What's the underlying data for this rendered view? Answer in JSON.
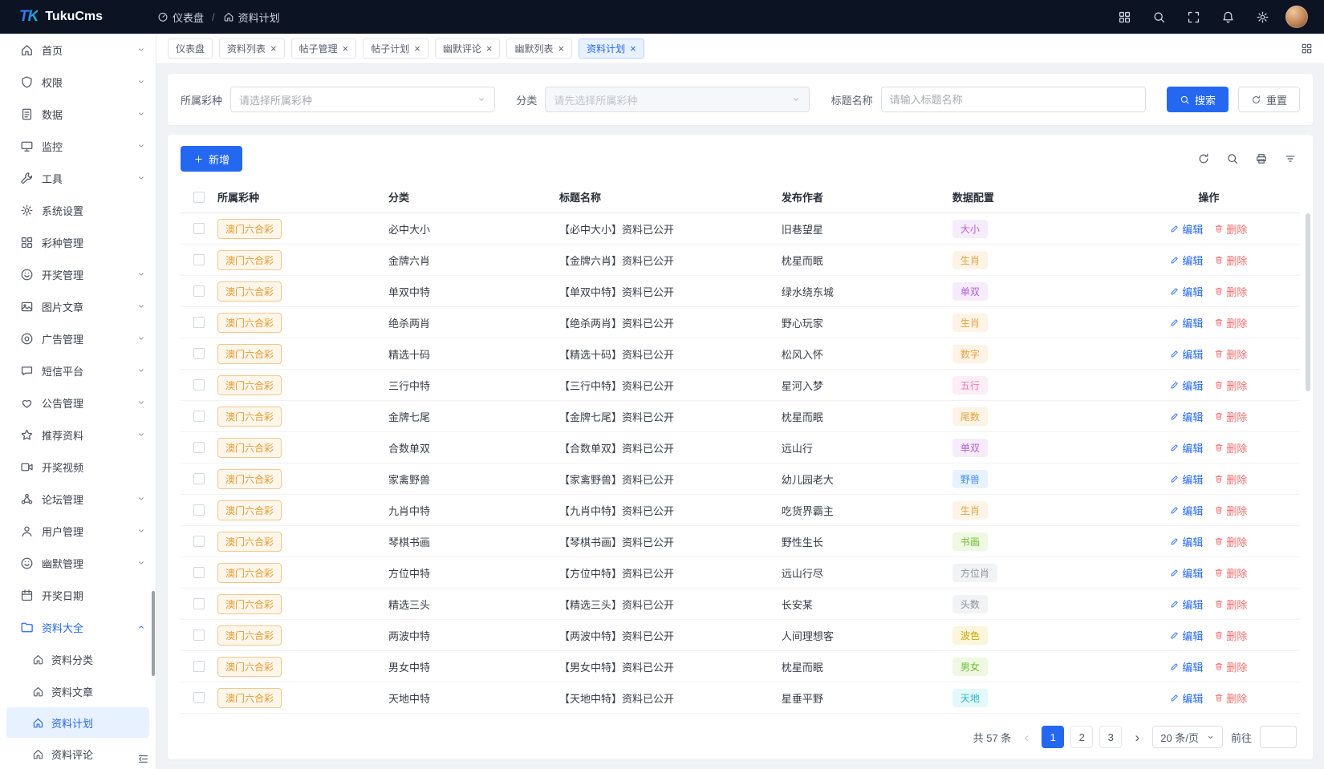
{
  "header": {
    "logo": "TK",
    "brand": "TukuCms",
    "breadcrumb": [
      {
        "label": "仪表盘",
        "icon": "dashboard"
      },
      {
        "label": "资料计划",
        "icon": "home"
      }
    ],
    "action_icons": [
      {
        "name": "apps"
      },
      {
        "name": "search"
      },
      {
        "name": "fullscreen"
      },
      {
        "name": "bell"
      },
      {
        "name": "gear"
      }
    ]
  },
  "sidebar": {
    "items": [
      {
        "label": "首页",
        "icon": "home",
        "chevron": true
      },
      {
        "label": "权限",
        "icon": "shield",
        "chevron": true
      },
      {
        "label": "数据",
        "icon": "doc",
        "chevron": true
      },
      {
        "label": "监控",
        "icon": "monitor",
        "chevron": true
      },
      {
        "label": "工具",
        "icon": "wrench",
        "chevron": true
      },
      {
        "label": "系统设置",
        "icon": "gear"
      },
      {
        "label": "彩种管理",
        "icon": "apps"
      },
      {
        "label": "开奖管理",
        "icon": "smile",
        "chevron": true
      },
      {
        "label": "图片文章",
        "icon": "image",
        "chevron": true
      },
      {
        "label": "广告管理",
        "icon": "target",
        "chevron": true
      },
      {
        "label": "短信平台",
        "icon": "message",
        "chevron": true
      },
      {
        "label": "公告管理",
        "icon": "heart",
        "chevron": true
      },
      {
        "label": "推荐资料",
        "icon": "star",
        "chevron": true
      },
      {
        "label": "开奖视频",
        "icon": "video"
      },
      {
        "label": "论坛管理",
        "icon": "cluster",
        "chevron": true
      },
      {
        "label": "用户管理",
        "icon": "user",
        "chevron": true
      },
      {
        "label": "幽默管理",
        "icon": "smile",
        "chevron": true
      },
      {
        "label": "开奖日期",
        "icon": "calendar"
      },
      {
        "label": "资料大全",
        "icon": "folder",
        "chevron": true,
        "expanded": true,
        "highlight": true,
        "children": [
          {
            "label": "资料分类",
            "icon": "home"
          },
          {
            "label": "资料文章",
            "icon": "home"
          },
          {
            "label": "资料计划",
            "icon": "home",
            "active": true
          },
          {
            "label": "资料评论",
            "icon": "home"
          }
        ]
      }
    ]
  },
  "tabs": {
    "items": [
      {
        "label": "仪表盘",
        "closable": false,
        "active": false
      },
      {
        "label": "资料列表",
        "closable": true,
        "active": false
      },
      {
        "label": "帖子管理",
        "closable": true,
        "active": false
      },
      {
        "label": "帖子计划",
        "closable": true,
        "active": false
      },
      {
        "label": "幽默评论",
        "closable": true,
        "active": false
      },
      {
        "label": "幽默列表",
        "closable": true,
        "active": false
      },
      {
        "label": "资料计划",
        "closable": true,
        "active": true
      }
    ]
  },
  "filters": {
    "lottery_label": "所属彩种",
    "lottery_placeholder": "请选择所属彩种",
    "category_label": "分类",
    "category_placeholder": "请先选择所属彩种",
    "title_label": "标题名称",
    "title_placeholder": "请输入标题名称",
    "search_button": "搜索",
    "reset_button": "重置"
  },
  "toolbar": {
    "add_button": "新增"
  },
  "table": {
    "columns": [
      "所属彩种",
      "分类",
      "标题名称",
      "发布作者",
      "数据配置",
      "操作"
    ],
    "edit_label": "编辑",
    "delete_label": "删除",
    "rows": [
      {
        "lottery": "澳门六合彩",
        "category": "必中大小",
        "title": "【必中大小】资料已公开",
        "author": "旧巷望星",
        "config": "大小",
        "config_color": "purple"
      },
      {
        "lottery": "澳门六合彩",
        "category": "金牌六肖",
        "title": "【金牌六肖】资料已公开",
        "author": "枕星而眠",
        "config": "生肖",
        "config_color": "orange"
      },
      {
        "lottery": "澳门六合彩",
        "category": "单双中特",
        "title": "【单双中特】资料已公开",
        "author": "绿水绕东城",
        "config": "单双",
        "config_color": "purple"
      },
      {
        "lottery": "澳门六合彩",
        "category": "绝杀两肖",
        "title": "【绝杀两肖】资料已公开",
        "author": "野心玩家",
        "config": "生肖",
        "config_color": "orange"
      },
      {
        "lottery": "澳门六合彩",
        "category": "精选十码",
        "title": "【精选十码】资料已公开",
        "author": "松风入怀",
        "config": "数字",
        "config_color": "orange"
      },
      {
        "lottery": "澳门六合彩",
        "category": "三行中特",
        "title": "【三行中特】资料已公开",
        "author": "星河入梦",
        "config": "五行",
        "config_color": "pink"
      },
      {
        "lottery": "澳门六合彩",
        "category": "金牌七尾",
        "title": "【金牌七尾】资料已公开",
        "author": "枕星而眠",
        "config": "尾数",
        "config_color": "orange"
      },
      {
        "lottery": "澳门六合彩",
        "category": "合数单双",
        "title": "【合数单双】资料已公开",
        "author": "远山行",
        "config": "单双",
        "config_color": "purple"
      },
      {
        "lottery": "澳门六合彩",
        "category": "家禽野兽",
        "title": "【家禽野兽】资料已公开",
        "author": "幼儿园老大",
        "config": "野兽",
        "config_color": "blue"
      },
      {
        "lottery": "澳门六合彩",
        "category": "九肖中特",
        "title": "【九肖中特】资料已公开",
        "author": "吃货界霸主",
        "config": "生肖",
        "config_color": "orange"
      },
      {
        "lottery": "澳门六合彩",
        "category": "琴棋书画",
        "title": "【琴棋书画】资料已公开",
        "author": "野性生长",
        "config": "书画",
        "config_color": "green"
      },
      {
        "lottery": "澳门六合彩",
        "category": "方位中特",
        "title": "【方位中特】资料已公开",
        "author": "远山行尽",
        "config": "方位肖",
        "config_color": "gray"
      },
      {
        "lottery": "澳门六合彩",
        "category": "精选三头",
        "title": "【精选三头】资料已公开",
        "author": "长安某",
        "config": "头数",
        "config_color": "gray"
      },
      {
        "lottery": "澳门六合彩",
        "category": "两波中特",
        "title": "【两波中特】资料已公开",
        "author": "人间理想客",
        "config": "波色",
        "config_color": "yellow"
      },
      {
        "lottery": "澳门六合彩",
        "category": "男女中特",
        "title": "【男女中特】资料已公开",
        "author": "枕星而眠",
        "config": "男女",
        "config_color": "green"
      },
      {
        "lottery": "澳门六合彩",
        "category": "天地中特",
        "title": "【天地中特】资料已公开",
        "author": "星垂平野",
        "config": "天地",
        "config_color": "cyan"
      }
    ]
  },
  "pagination": {
    "total": "共 57 条",
    "pages": [
      "1",
      "2",
      "3"
    ],
    "active_page": "1",
    "page_size": "20 条/页",
    "goto_label": "前往"
  },
  "colors": {
    "primary": "#2468f2",
    "danger": "#f56c6c",
    "lottery_badge": "#e69b2e",
    "header_bg": "#0c1424"
  }
}
